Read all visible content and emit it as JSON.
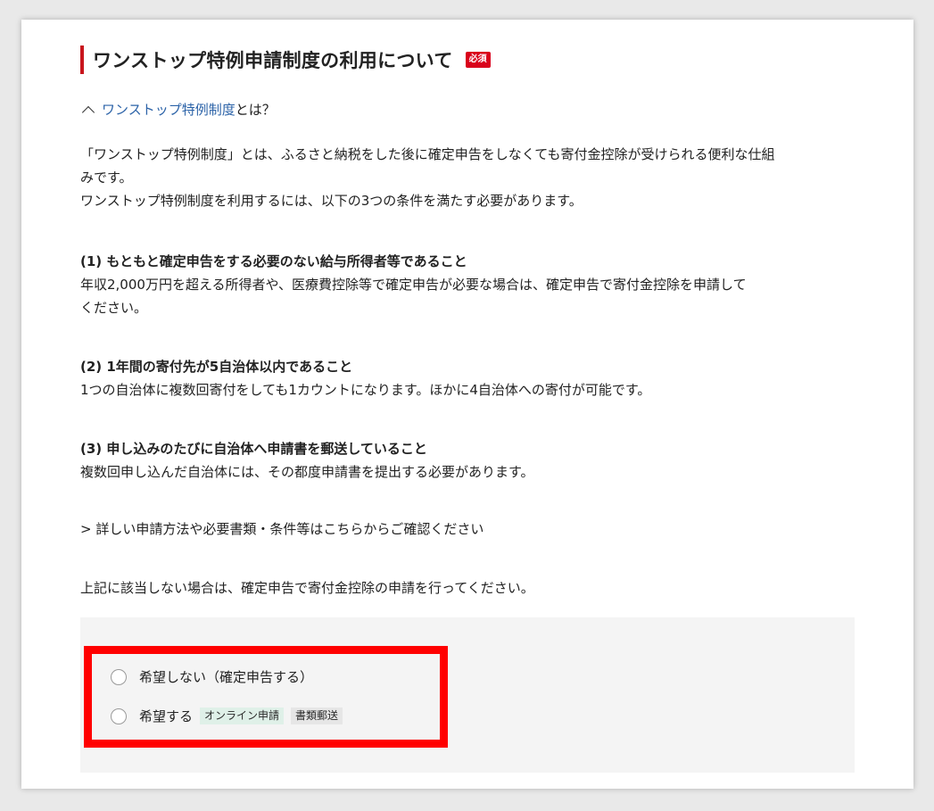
{
  "heading": {
    "title": "ワンストップ特例申請制度の利用について",
    "required_badge": "必須"
  },
  "toggle": {
    "link_text": "ワンストップ特例制度",
    "suffix": "とは？"
  },
  "intro": {
    "line1": "「ワンストップ特例制度」とは、ふるさと納税をした後に確定申告をしなくても寄付金控除が受けられる便利な仕組",
    "line2": "みです。",
    "line3": "ワンストップ特例制度を利用するには、以下の3つの条件を満たす必要があります。"
  },
  "conditions": [
    {
      "title": "(1) もともと確定申告をする必要のない給与所得者等であること",
      "line1": "年収2,000万円を超える所得者や、医療費控除等で確定申告が必要な場合は、確定申告で寄付金控除を申請して",
      "line2": "ください。"
    },
    {
      "title": "(2) 1年間の寄付先が5自治体以内であること",
      "line1": "1つの自治体に複数回寄付をしても1カウントになります。ほかに4自治体への寄付が可能です。"
    },
    {
      "title": "(3) 申し込みのたびに自治体へ申請書を郵送していること",
      "line1": "複数回申し込んだ自治体には、その都度申請書を提出する必要があります。"
    }
  ],
  "details_link": "> 詳しい申請方法や必要書類・条件等はこちらからご確認ください",
  "note": "上記に該当しない場合は、確定申告で寄付金控除の申請を行ってください。",
  "options": [
    {
      "label": "希望しない（確定申告する）"
    },
    {
      "label": "希望する",
      "tags": [
        "オンライン申請",
        "書類郵送"
      ]
    }
  ],
  "colors": {
    "accent_red": "#c8161d",
    "link_blue": "#2c63a8",
    "highlight_red": "#ff0000"
  }
}
